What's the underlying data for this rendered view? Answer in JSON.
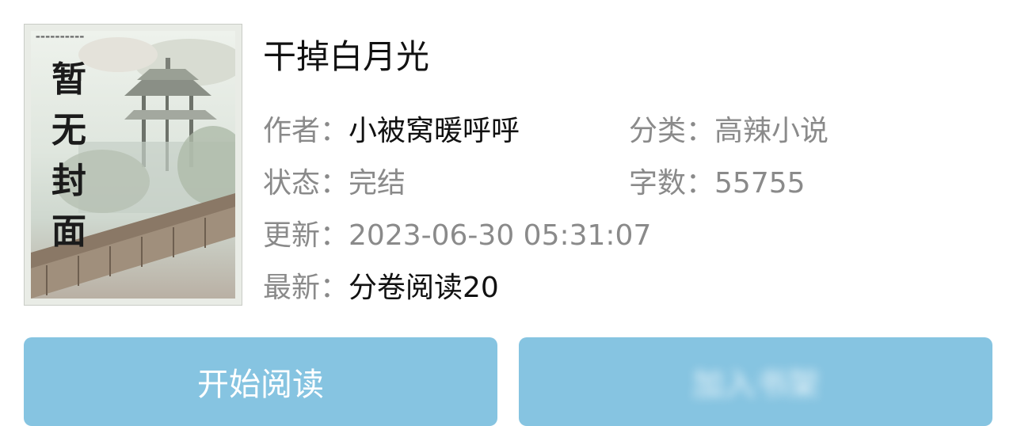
{
  "book": {
    "cover_text": [
      "暂",
      "无",
      "封",
      "面"
    ],
    "title": "干掉白月光",
    "author_label": "作者：",
    "author": "小被窝暖呼呼",
    "category_label": "分类：",
    "category": "高辣小说",
    "status_label": "状态：",
    "status": "完结",
    "word_count_label": "字数：",
    "word_count": "55755",
    "updated_label": "更新：",
    "updated": "2023-06-30 05:31:07",
    "latest_label": "最新：",
    "latest": "分卷阅读20"
  },
  "actions": {
    "start_reading": "开始阅读",
    "second_button": "加入书架"
  },
  "colors": {
    "button_bg": "#86c4e1",
    "label_gray": "#8a8a8a",
    "text_dark": "#111111"
  }
}
